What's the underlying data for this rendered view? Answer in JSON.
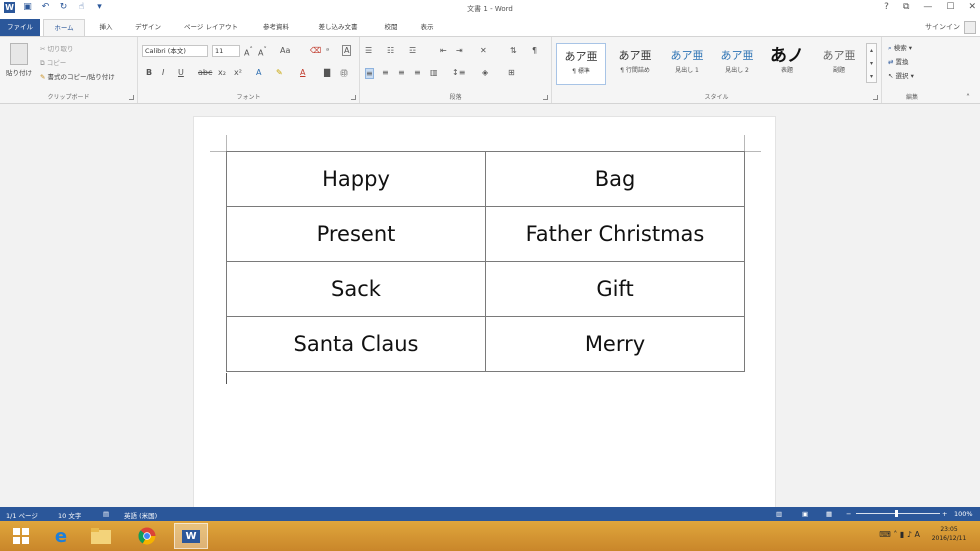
{
  "titlebar": {
    "title": "文書 1 - Word",
    "help": "?",
    "restore": "⧉",
    "minimize": "—",
    "maximize": "☐",
    "close": "✕"
  },
  "tabs": {
    "file": "ファイル",
    "home": "ホーム",
    "insert": "挿入",
    "design": "デザイン",
    "layout": "ページ レイアウト",
    "references": "参考資料",
    "mailings": "差し込み文書",
    "review": "校閲",
    "view": "表示",
    "signin": "サインイン"
  },
  "ribbon": {
    "clipboard": {
      "label": "クリップボード",
      "paste": "貼り付け",
      "cut": "切り取り",
      "copy": "コピー",
      "format_painter": "書式のコピー/貼り付け"
    },
    "font": {
      "label": "フォント",
      "font_name": "Calibri (本文)",
      "font_size": "11"
    },
    "paragraph": {
      "label": "段落"
    },
    "styles": {
      "label": "スタイル",
      "items": [
        {
          "sample": "あア亜",
          "name": "¶ 標準"
        },
        {
          "sample": "あア亜",
          "name": "¶ 行間詰め"
        },
        {
          "sample": "あア亜",
          "name": "見出し 1"
        },
        {
          "sample": "あア亜",
          "name": "見出し 2"
        },
        {
          "sample": "あノ",
          "name": "表題"
        },
        {
          "sample": "あア亜",
          "name": "副題"
        }
      ]
    },
    "editing": {
      "label": "編集",
      "find": "検索",
      "replace": "置換",
      "select": "選択"
    }
  },
  "document": {
    "table": [
      [
        "Happy",
        "Bag"
      ],
      [
        "Present",
        "Father Christmas"
      ],
      [
        "Sack",
        "Gift"
      ],
      [
        "Santa Claus",
        "Merry"
      ]
    ]
  },
  "statusbar": {
    "page": "1/1 ページ",
    "words": "10 文字",
    "language": "英語 (米国)",
    "zoom": "100%"
  },
  "taskbar": {
    "clock_time": "23:05",
    "clock_date": "2016/12/11"
  }
}
